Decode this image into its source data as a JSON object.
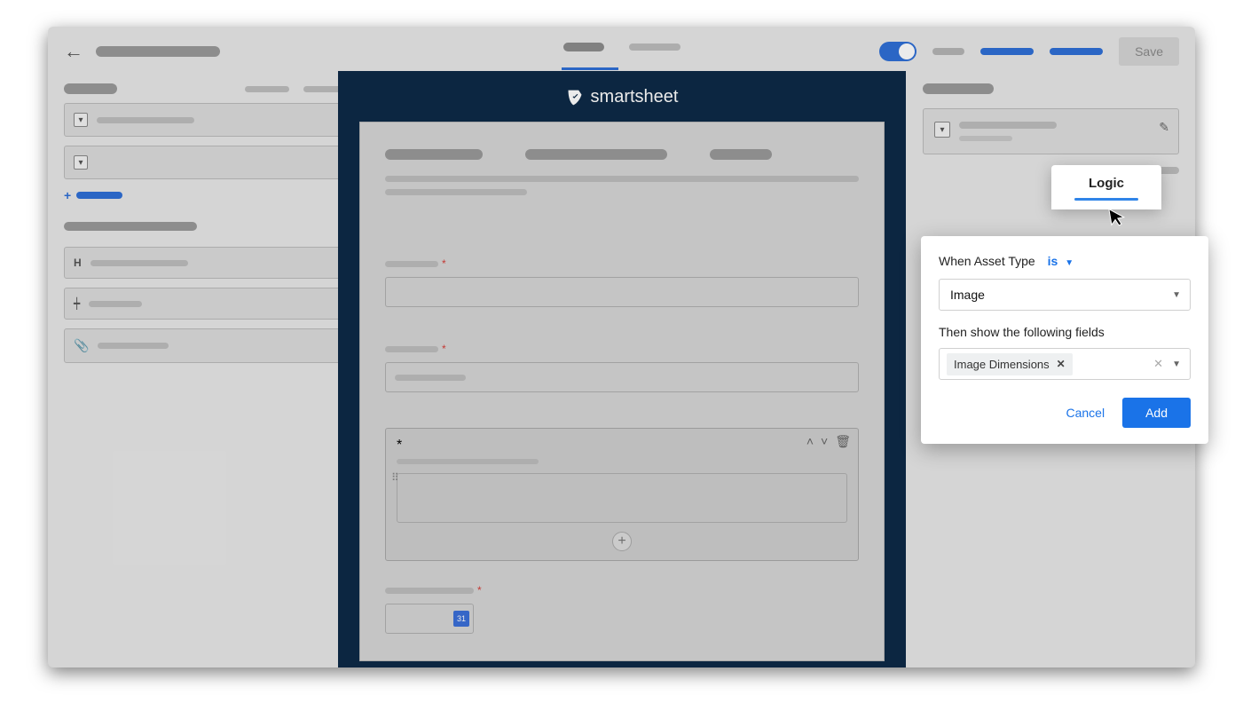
{
  "header": {
    "save_label": "Save"
  },
  "brand": "smartsheet",
  "logic_popover": {
    "tab_label": "Logic",
    "when_prefix": "When",
    "when_field": "Asset Type",
    "operator": "is",
    "condition_value": "Image",
    "then_label": "Then show the following fields",
    "selected_field_chip": "Image Dimensions",
    "cancel_label": "Cancel",
    "add_label": "Add"
  },
  "date_icon_label": "31"
}
